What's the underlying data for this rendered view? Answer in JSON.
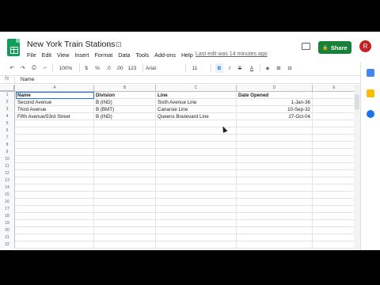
{
  "doc": {
    "title": "New York Train Stations",
    "star_icon": "☆",
    "folder_icon": "⊡",
    "last_edit": "Last edit was 14 minutes ago"
  },
  "menu": [
    "File",
    "Edit",
    "View",
    "Insert",
    "Format",
    "Data",
    "Tools",
    "Add-ons",
    "Help"
  ],
  "share": {
    "label": "Share",
    "icon": "🔒"
  },
  "avatar": {
    "initial": "R",
    "color": "#c5221f"
  },
  "toolbar": {
    "undo": "↶",
    "redo": "↷",
    "print": "⎙",
    "paint_format": "⌐",
    "zoom": "100%",
    "currency": "$",
    "percent": "%",
    "dec_decrease": ".0",
    "dec_increase": ".00",
    "more_formats": "123",
    "font": "Arial",
    "font_size": "11",
    "bold": "B",
    "italic": "I",
    "strike": "S",
    "text_color": "A",
    "fill": "◈",
    "borders": "⊞",
    "merge": "⊟"
  },
  "formula_bar": {
    "fx": "fx",
    "value": "Name"
  },
  "columns": [
    "A",
    "B",
    "C",
    "D",
    "E"
  ],
  "table": {
    "headers": [
      "Name",
      "Division",
      "Line",
      "Date Opened"
    ],
    "rows": [
      [
        "Second Avenue",
        "B (IND)",
        "Sixth Avenue Line",
        "1-Jan-36"
      ],
      [
        "Third Avenue",
        "B (BMT)",
        "Canarsie Line",
        "10-Sep-32"
      ],
      [
        "Fifth Avenue/53rd Street",
        "B (IND)",
        "Queens Boulevard Line",
        "27-Oct-04"
      ]
    ]
  },
  "row_numbers": [
    "1",
    "2",
    "3",
    "4",
    "5",
    "6",
    "7",
    "8",
    "9",
    "10",
    "11",
    "12",
    "13",
    "14",
    "15",
    "16",
    "17",
    "18",
    "19",
    "20",
    "21",
    "22"
  ],
  "colors": {
    "accent": "#1a73e8",
    "share": "#188038",
    "sheets_green": "#0f9d58"
  }
}
